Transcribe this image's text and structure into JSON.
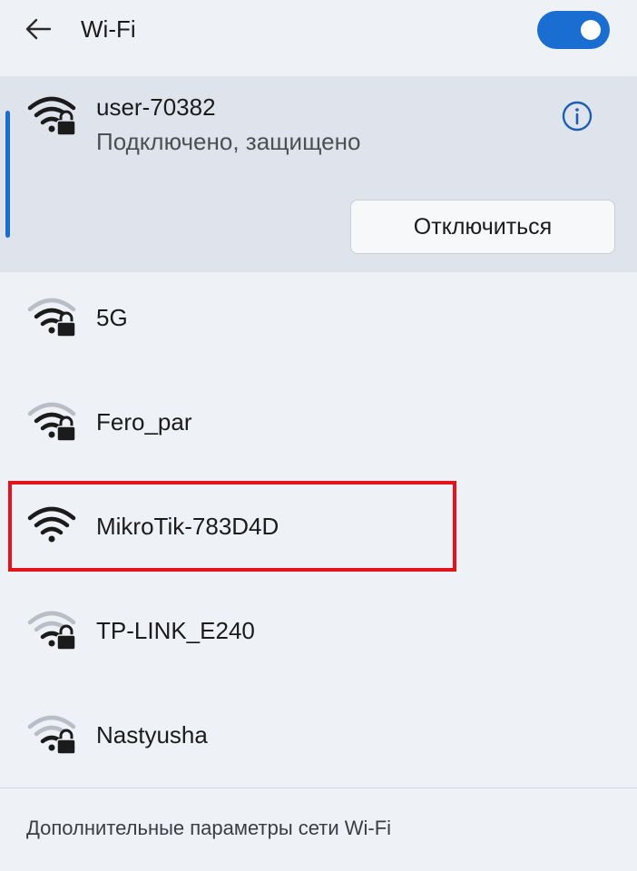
{
  "header": {
    "title": "Wi-Fi",
    "back_icon": "arrow-left-icon",
    "toggle_state": "on",
    "accent_color": "#1b6ed1"
  },
  "connected_network": {
    "name": "user-70382",
    "status": "Подключено, защищено",
    "icon": "wifi-secured-icon",
    "info_icon": "info-icon",
    "disconnect_label": "Отключиться"
  },
  "networks": [
    {
      "name": "5G",
      "icon": "wifi-secured-weak-icon",
      "secured": true
    },
    {
      "name": "Fero_par",
      "icon": "wifi-secured-weak-icon",
      "secured": true
    },
    {
      "name": "MikroTik-783D4D",
      "icon": "wifi-open-icon",
      "secured": false,
      "highlighted": true,
      "highlight_color": "#e5141c"
    },
    {
      "name": "TP-LINK_E240",
      "icon": "wifi-secured-weak-icon",
      "secured": true
    },
    {
      "name": "Nastyusha",
      "icon": "wifi-secured-weak-icon",
      "secured": true
    }
  ],
  "footer": {
    "link_text": "Дополнительные параметры сети Wi-Fi"
  }
}
